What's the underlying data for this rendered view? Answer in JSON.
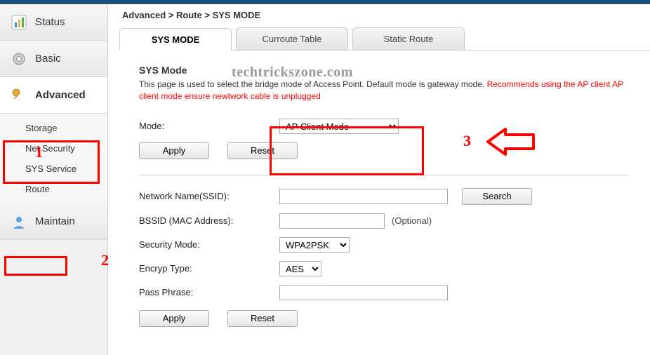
{
  "breadcrumb": "Advanced > Route > SYS MODE",
  "watermark": "techtrickszone.com",
  "sidebar": {
    "items": [
      {
        "label": "Status"
      },
      {
        "label": "Basic"
      },
      {
        "label": "Advanced"
      },
      {
        "label": "Maintain"
      }
    ],
    "sub": [
      {
        "label": "Storage"
      },
      {
        "label": "Net Security"
      },
      {
        "label": "SYS Service"
      },
      {
        "label": "Route"
      }
    ]
  },
  "tabs": [
    {
      "label": "SYS MODE"
    },
    {
      "label": "Curroute Table"
    },
    {
      "label": "Static Route"
    }
  ],
  "section": {
    "title": "SYS Mode",
    "desc_plain": "This page is used to select the bridge mode of Access Point. Default mode is gateway mode. ",
    "desc_red": "Recommends using the AP client AP client mode ensure newtwork cable is unplugged"
  },
  "form": {
    "mode_label": "Mode:",
    "mode_value": "AP Client Mode",
    "apply": "Apply",
    "reset": "Reset",
    "ssid_label": "Network Name(SSID):",
    "ssid_value": "",
    "search": "Search",
    "bssid_label": "BSSID (MAC Address):",
    "bssid_value": "",
    "optional": "(Optional)",
    "sec_label": "Security Mode:",
    "sec_value": "WPA2PSK",
    "enc_label": "Encryp Type:",
    "enc_value": "AES",
    "pass_label": "Pass Phrase:",
    "pass_value": ""
  },
  "anno": {
    "n1": "1",
    "n2": "2",
    "n3": "3"
  }
}
